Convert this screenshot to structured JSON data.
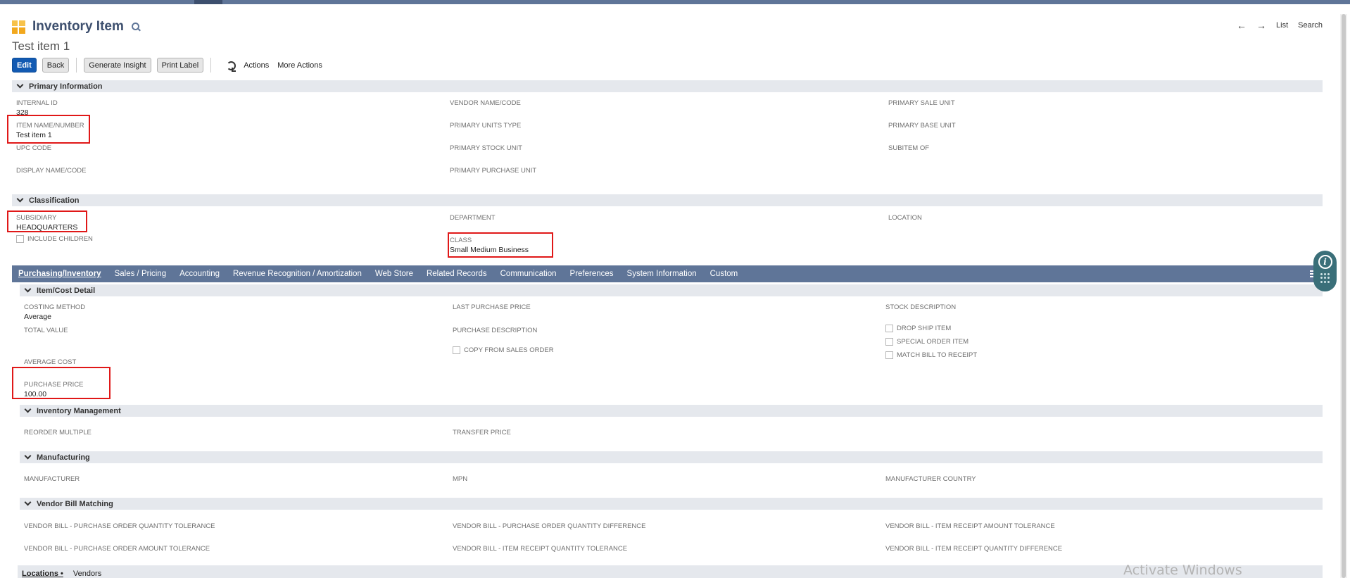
{
  "header": {
    "record_type": "Inventory Item",
    "record_name": "Test item 1"
  },
  "nav": {
    "prev_arrow": "←",
    "next_arrow": "→",
    "list": "List",
    "search": "Search"
  },
  "toolbar": {
    "edit": "Edit",
    "back": "Back",
    "generate_insight": "Generate Insight",
    "print_label": "Print Label",
    "actions": "Actions",
    "more_actions": "More Actions"
  },
  "primary_info": {
    "title": "Primary Information",
    "internal_id_label": "INTERNAL ID",
    "internal_id": "328",
    "item_name_label": "ITEM NAME/NUMBER",
    "item_name": "Test item 1",
    "upc_code_label": "UPC CODE",
    "display_name_label": "DISPLAY NAME/CODE",
    "vendor_name_label": "VENDOR NAME/CODE",
    "primary_units_type_label": "PRIMARY UNITS TYPE",
    "primary_stock_unit_label": "PRIMARY STOCK UNIT",
    "primary_purchase_unit_label": "PRIMARY PURCHASE UNIT",
    "primary_sale_unit_label": "PRIMARY SALE UNIT",
    "primary_base_unit_label": "PRIMARY BASE UNIT",
    "subitem_of_label": "SUBITEM OF"
  },
  "classification": {
    "title": "Classification",
    "subsidiary_label": "SUBSIDIARY",
    "subsidiary": "HEADQUARTERS",
    "include_children_label": "INCLUDE CHILDREN",
    "department_label": "DEPARTMENT",
    "class_label": "CLASS",
    "class_value": "Small Medium Business",
    "location_label": "LOCATION"
  },
  "subtabs": [
    "Purchasing/Inventory",
    "Sales / Pricing",
    "Accounting",
    "Revenue Recognition / Amortization",
    "Web Store",
    "Related Records",
    "Communication",
    "Preferences",
    "System Information",
    "Custom"
  ],
  "item_cost": {
    "title": "Item/Cost Detail",
    "costing_method_label": "COSTING METHOD",
    "costing_method": "Average",
    "total_value_label": "TOTAL VALUE",
    "average_cost_label": "AVERAGE COST",
    "purchase_price_label": "PURCHASE PRICE",
    "purchase_price": "100.00",
    "last_purchase_price_label": "LAST PURCHASE PRICE",
    "purchase_description_label": "PURCHASE DESCRIPTION",
    "copy_from_sales_order_label": "COPY FROM SALES ORDER",
    "stock_description_label": "STOCK DESCRIPTION",
    "drop_ship_item_label": "DROP SHIP ITEM",
    "special_order_item_label": "SPECIAL ORDER ITEM",
    "match_bill_label": "MATCH BILL TO RECEIPT"
  },
  "inventory_mgmt": {
    "title": "Inventory Management",
    "reorder_multiple_label": "REORDER MULTIPLE",
    "transfer_price_label": "TRANSFER PRICE"
  },
  "manufacturing": {
    "title": "Manufacturing",
    "manufacturer_label": "MANUFACTURER",
    "mpn_label": "MPN",
    "manufacturer_country_label": "MANUFACTURER COUNTRY"
  },
  "vendor_bill": {
    "title": "Vendor Bill Matching",
    "po_qty_tolerance": "VENDOR BILL - PURCHASE ORDER QUANTITY TOLERANCE",
    "po_amount_tolerance": "VENDOR BILL - PURCHASE ORDER AMOUNT TOLERANCE",
    "po_qty_difference": "VENDOR BILL - PURCHASE ORDER QUANTITY DIFFERENCE",
    "ir_qty_tolerance": "VENDOR BILL - ITEM RECEIPT QUANTITY TOLERANCE",
    "ir_amount_tolerance": "VENDOR BILL - ITEM RECEIPT AMOUNT TOLERANCE",
    "ir_qty_difference": "VENDOR BILL - ITEM RECEIPT QUANTITY DIFFERENCE"
  },
  "bottom_tabs": {
    "locations": "Locations •",
    "vendors": "Vendors"
  },
  "system": {
    "watermark": "Activate Windows"
  },
  "colors": {
    "accent": "#5f7598",
    "primary_button": "#125ab2",
    "highlight": "#e01818"
  }
}
